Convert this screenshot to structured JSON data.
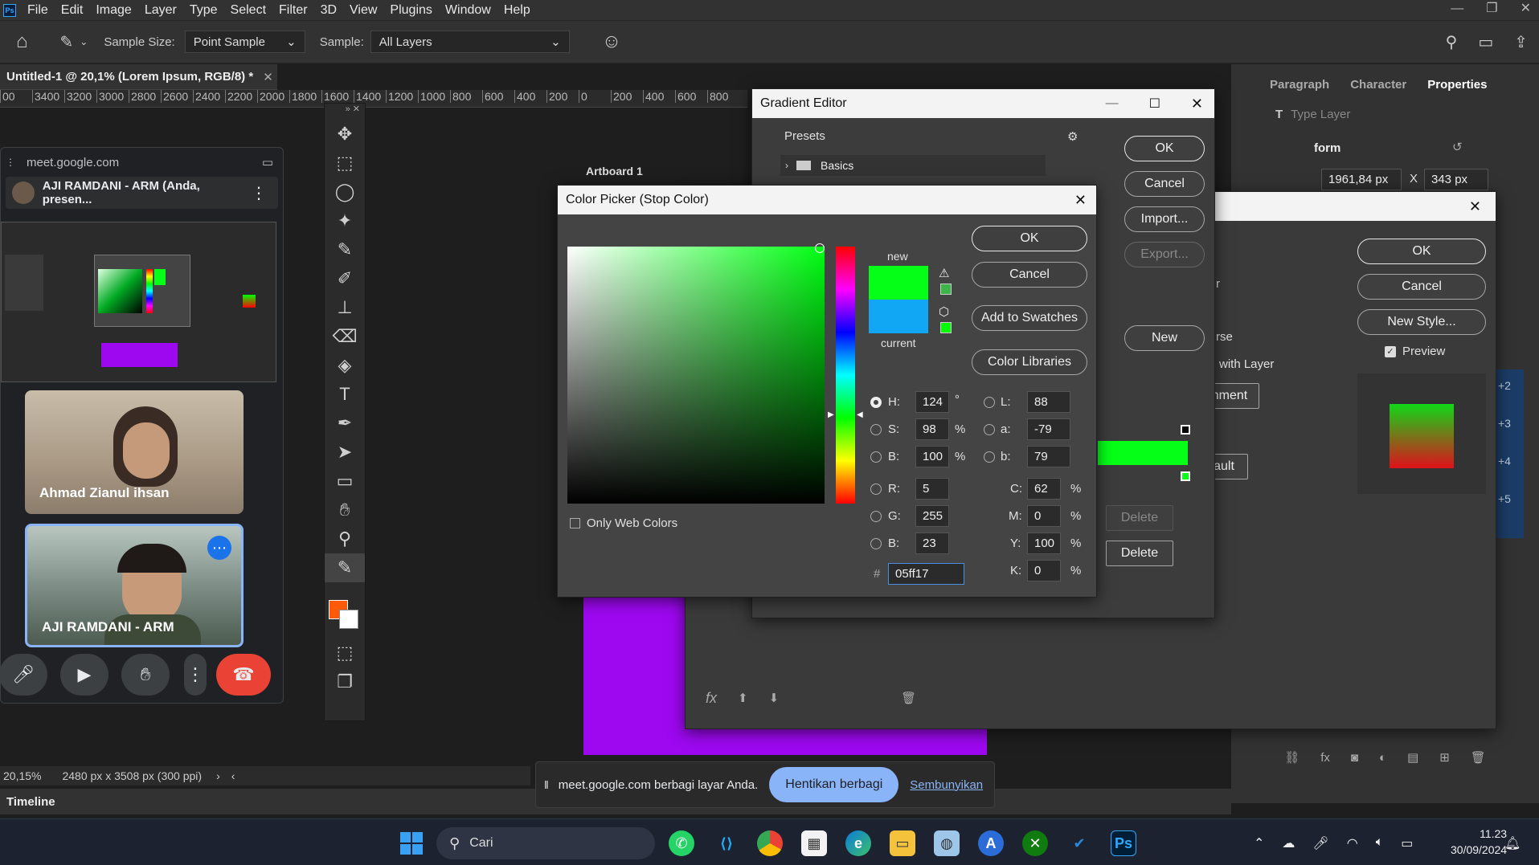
{
  "app": {
    "menus": [
      "File",
      "Edit",
      "Image",
      "Layer",
      "Type",
      "Select",
      "Filter",
      "3D",
      "View",
      "Plugins",
      "Window",
      "Help"
    ],
    "ps_label": "Ps"
  },
  "options": {
    "sample_size_label": "Sample Size:",
    "sample_size_value": "Point Sample",
    "sample_label": "Sample:",
    "sample_value": "All Layers"
  },
  "document": {
    "tab_title": "Untitled-1 @ 20,1% (Lorem Ipsum, RGB/8) *",
    "ruler": [
      "00",
      "3400",
      "3200",
      "3000",
      "2800",
      "2600",
      "2400",
      "2200",
      "2000",
      "1800",
      "1600",
      "1400",
      "1200",
      "1000",
      "800",
      "600",
      "400",
      "200",
      "0",
      "200",
      "400",
      "600",
      "800"
    ],
    "artboard_label": "Artboard 1",
    "zoom": "20,15%",
    "dimensions": "2480 px x 3508 px (300 ppi)"
  },
  "meet": {
    "url": "meet.google.com",
    "presenter": "AJI RAMDANI - ARM (Anda, presen...",
    "participant1": "Ahmad Zianul ihsan",
    "participant2": "AJI RAMDANI - ARM",
    "share_message": "meet.google.com berbagi layar Anda.",
    "stop_share": "Hentikan berbagi",
    "hide": "Sembunyikan"
  },
  "gradient_editor": {
    "title": "Gradient Editor",
    "presets_label": "Presets",
    "folder": "Basics",
    "ok": "OK",
    "cancel": "Cancel",
    "import": "Import...",
    "export": "Export...",
    "new": "New",
    "delete1": "Delete",
    "delete2": "Delete"
  },
  "color_picker": {
    "title": "Color Picker (Stop Color)",
    "ok": "OK",
    "cancel": "Cancel",
    "add_swatches": "Add to Swatches",
    "color_libraries": "Color Libraries",
    "new_label": "new",
    "current_label": "current",
    "only_web": "Only Web Colors",
    "H": "124",
    "S": "98",
    "B": "100",
    "R": "5",
    "G": "255",
    "Bv": "23",
    "L": "88",
    "a": "-79",
    "b": "79",
    "C": "62",
    "M": "0",
    "Y": "100",
    "K": "0",
    "hex": "05ff17",
    "deg": "°",
    "pct": "%",
    "new_color": "#05ff17",
    "current_color": "#12a7f4"
  },
  "layer_style": {
    "ok": "OK",
    "cancel": "Cancel",
    "new_style": "New Style...",
    "preview": "Preview",
    "frag_r": "r",
    "frag_rse": "rse",
    "frag_with_layer": "with Layer",
    "frag_alignment": "nment",
    "frag_ault": "ault"
  },
  "properties": {
    "tabs": [
      "Paragraph",
      "Character",
      "Properties"
    ],
    "type_layer": "Type Layer",
    "transform": "form",
    "w": "1961,84 px",
    "x_label": "X",
    "x": "343 px",
    "badges": [
      "+2",
      "+3",
      "+4",
      "+5"
    ]
  },
  "timeline": {
    "label": "Timeline"
  },
  "taskbar": {
    "search": "Cari",
    "time": "11.23",
    "date": "30/09/2024"
  }
}
